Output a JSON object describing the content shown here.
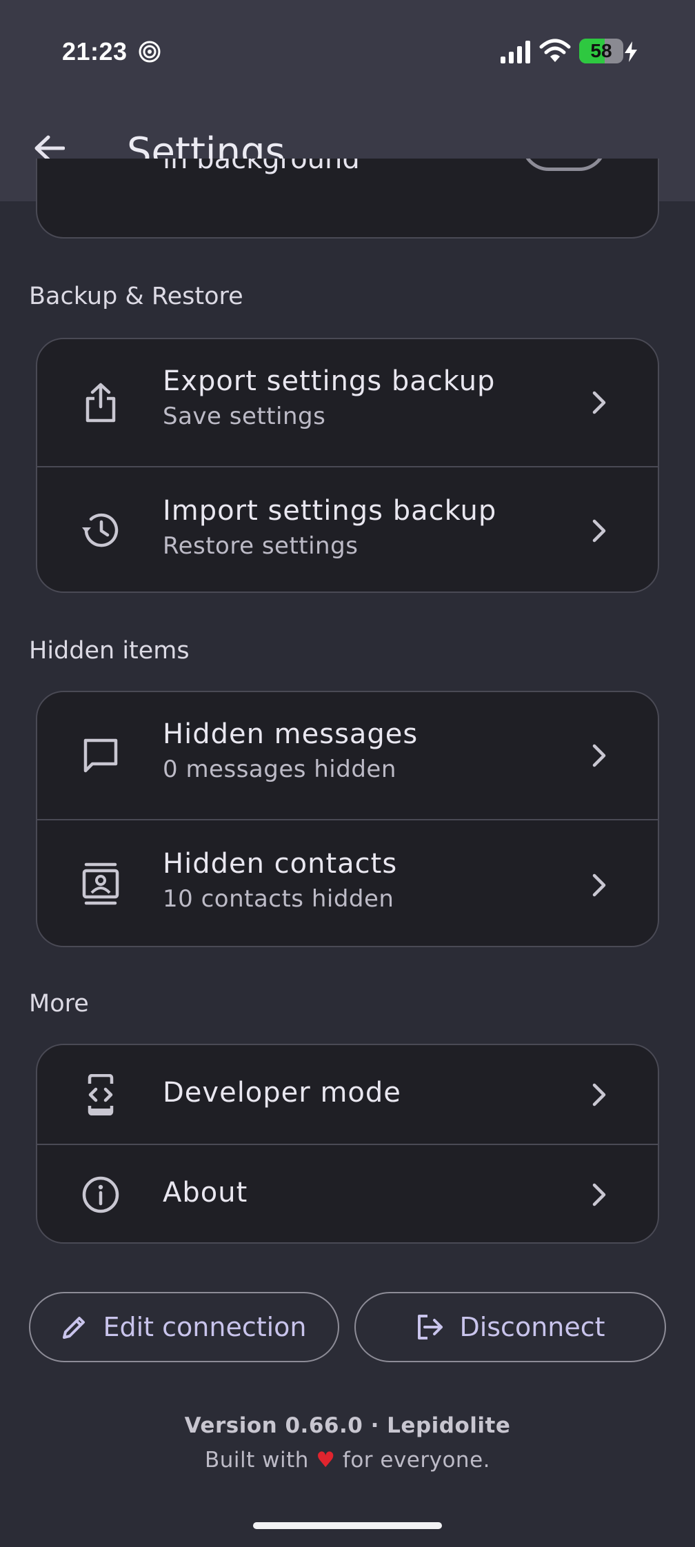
{
  "status_bar": {
    "time": "21:23",
    "battery_level": "58",
    "battery_fraction": 0.58,
    "icons": [
      "spiral-icon",
      "signal-icon",
      "wifi-icon",
      "battery-icon",
      "charging-bolt-icon"
    ]
  },
  "header": {
    "title": "Settings",
    "back_icon": "arrow-left-icon"
  },
  "partial_item": {
    "label": "in background"
  },
  "sections": [
    {
      "label": "Backup & Restore",
      "items": [
        {
          "title": "Export settings backup",
          "subtitle": "Save settings",
          "icon": "share-upload-icon"
        },
        {
          "title": "Import settings backup",
          "subtitle": "Restore settings",
          "icon": "history-restore-icon"
        }
      ]
    },
    {
      "label": "Hidden items",
      "items": [
        {
          "title": "Hidden messages",
          "subtitle": "0 messages hidden",
          "icon": "message-bubble-icon"
        },
        {
          "title": "Hidden contacts",
          "subtitle": "10 contacts hidden",
          "icon": "contacts-book-icon"
        }
      ]
    },
    {
      "label": "More",
      "items": [
        {
          "title": "Developer mode",
          "icon": "developer-phone-icon"
        },
        {
          "title": "About",
          "icon": "info-icon"
        }
      ]
    }
  ],
  "actions": {
    "edit_connection": "Edit connection",
    "disconnect": "Disconnect"
  },
  "footer": {
    "version": "Version 0.66.0 · Lepidolite",
    "built_prefix": "Built with",
    "built_suffix": "for everyone.",
    "heart": "♥"
  },
  "colors": {
    "background": "#2b2c36",
    "header": "#3a3a47",
    "card": "#1f1f25",
    "accent": "#c9c4ec",
    "heart": "#e0242e"
  }
}
